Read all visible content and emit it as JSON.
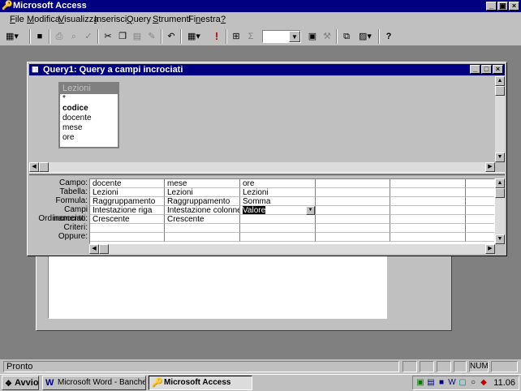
{
  "app": {
    "title": "Microsoft Access",
    "controls": {
      "minimize": "_",
      "restore": "▣",
      "close": "×"
    }
  },
  "menu": {
    "items": [
      {
        "id": "file",
        "u": "F",
        "rest": "ile"
      },
      {
        "id": "modifica",
        "u": "M",
        "rest": "odifica"
      },
      {
        "id": "visualizza",
        "u": "V",
        "rest": "isualizza"
      },
      {
        "id": "inserisci",
        "u": "I",
        "rest": "nserisci"
      },
      {
        "id": "query",
        "u": "Q",
        "rest": "uery"
      },
      {
        "id": "strumenti",
        "u": "S",
        "rest": "trumenti"
      },
      {
        "id": "finestra",
        "pre": "Fi",
        "u": "n",
        "rest": "estra"
      },
      {
        "id": "help",
        "u": "?",
        "rest": ""
      }
    ]
  },
  "toolbar": {
    "icons": [
      "view-icon",
      "save-icon",
      "print-icon",
      "print-preview-icon",
      "spelling-icon",
      "cut-icon",
      "copy-icon",
      "paste-icon",
      "format-painter-icon",
      "undo-icon",
      "query-type-icon",
      "run-icon",
      "show-table-icon",
      "totals-icon",
      "properties-icon",
      "build-icon",
      "database-window-icon",
      "new-object-icon",
      "help-icon"
    ],
    "run_glyph": "!",
    "totals_glyph": "Σ",
    "help_glyph": "?"
  },
  "query_window": {
    "title": "Query1: Query a campi incrociati",
    "table": {
      "name": "Lezioni",
      "fields": [
        {
          "name": "*",
          "bold": false
        },
        {
          "name": "codice",
          "bold": true
        },
        {
          "name": "docente",
          "bold": false
        },
        {
          "name": "mese",
          "bold": false
        },
        {
          "name": "ore",
          "bold": false
        }
      ]
    },
    "grid": {
      "row_labels": [
        "Campo:",
        "Tabella:",
        "Formula:",
        "Campi incrociati:",
        "Ordinamento:",
        "Criteri:",
        "Oppure:"
      ],
      "columns": [
        {
          "campo": "docente",
          "tabella": "Lezioni",
          "formula": "Raggruppamento",
          "campi_incrociati": "Intestazione riga",
          "ordinamento": "Crescente"
        },
        {
          "campo": "mese",
          "tabella": "Lezioni",
          "formula": "Raggruppamento",
          "campi_incrociati": "Intestazione colonne",
          "ordinamento": "Crescente"
        },
        {
          "campo": "ore",
          "tabella": "Lezioni",
          "formula": "Somma",
          "campi_incrociati": "Valore",
          "ordinamento": ""
        },
        {
          "campo": "",
          "tabella": "",
          "formula": "",
          "campi_incrociati": "",
          "ordinamento": ""
        },
        {
          "campo": "",
          "tabella": "",
          "formula": "",
          "campi_incrociati": "",
          "ordinamento": ""
        }
      ]
    }
  },
  "status": {
    "text": "Pronto",
    "num": "NUM"
  },
  "taskbar": {
    "start": "Avvio",
    "tasks": [
      {
        "label": "Microsoft Word - Banche d...",
        "active": false
      },
      {
        "label": "Microsoft Access",
        "active": true
      }
    ],
    "clock": "11.06"
  }
}
